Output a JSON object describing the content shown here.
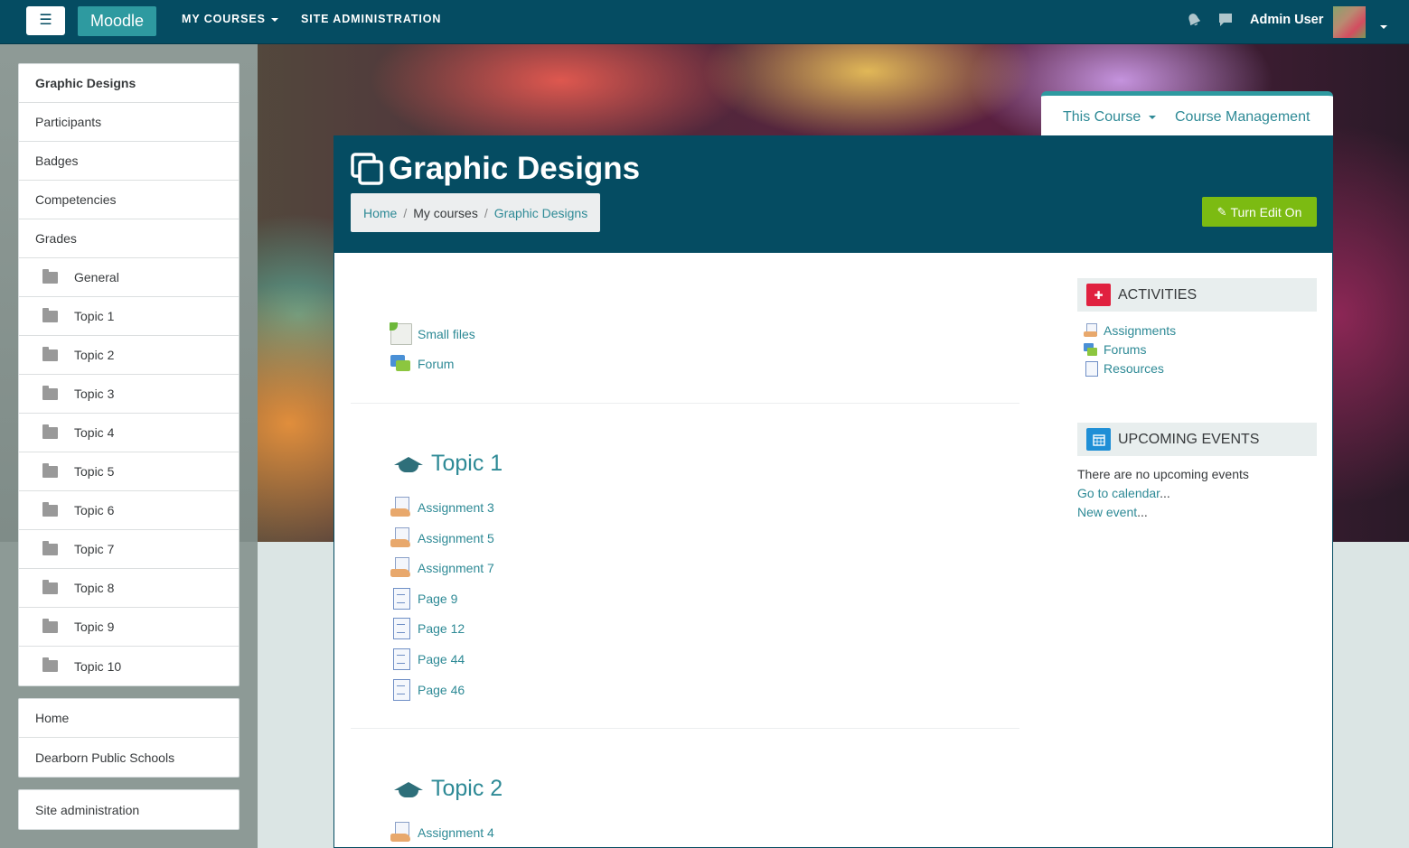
{
  "navbar": {
    "toggle_icon": "☰",
    "brand": "Moodle",
    "my_courses": "MY COURSES",
    "site_admin": "SITE ADMINISTRATION",
    "notifications_icon": "bell-icon",
    "messages_icon": "message-icon",
    "user_name": "Admin User"
  },
  "sidebar": {
    "course_nav": [
      {
        "label": "Graphic Designs",
        "bold": true
      },
      {
        "label": "Participants"
      },
      {
        "label": "Badges"
      },
      {
        "label": "Competencies"
      },
      {
        "label": "Grades"
      },
      {
        "label": "General",
        "folder": true
      },
      {
        "label": "Topic 1",
        "folder": true
      },
      {
        "label": "Topic 2",
        "folder": true
      },
      {
        "label": "Topic 3",
        "folder": true
      },
      {
        "label": "Topic 4",
        "folder": true
      },
      {
        "label": "Topic 5",
        "folder": true
      },
      {
        "label": "Topic 6",
        "folder": true
      },
      {
        "label": "Topic 7",
        "folder": true
      },
      {
        "label": "Topic 8",
        "folder": true
      },
      {
        "label": "Topic 9",
        "folder": true
      },
      {
        "label": "Topic 10",
        "folder": true
      }
    ],
    "site_nav": [
      "Home",
      "Dearborn Public Schools"
    ],
    "admin_nav": [
      "Site administration"
    ]
  },
  "course_tabs": {
    "this_course": "This Course",
    "course_management": "Course Management"
  },
  "header": {
    "title": "Graphic Designs",
    "breadcrumb": {
      "home": "Home",
      "sep": "/",
      "my_courses": "My courses",
      "current": "Graphic Designs"
    },
    "edit_button": "Turn Edit On"
  },
  "content": {
    "general_activities": [
      {
        "label": "Small files",
        "icon": "file"
      },
      {
        "label": "Forum",
        "icon": "forum"
      }
    ],
    "topic1": {
      "title": "Topic 1",
      "activities": [
        {
          "label": "Assignment 3",
          "icon": "assign"
        },
        {
          "label": "Assignment 5",
          "icon": "assign"
        },
        {
          "label": "Assignment 7",
          "icon": "assign"
        },
        {
          "label": "Page 9",
          "icon": "page"
        },
        {
          "label": "Page 12",
          "icon": "page"
        },
        {
          "label": "Page 44",
          "icon": "page"
        },
        {
          "label": "Page 46",
          "icon": "page"
        }
      ]
    },
    "topic2": {
      "title": "Topic 2",
      "activities": [
        {
          "label": "Assignment 4",
          "icon": "assign"
        }
      ]
    }
  },
  "blocks": {
    "activities": {
      "title": "ACTIVITIES",
      "icon_color": "#e0213f",
      "links": [
        {
          "label": "Assignments",
          "icon": "assign"
        },
        {
          "label": "Forums",
          "icon": "forum"
        },
        {
          "label": "Resources",
          "icon": "page"
        }
      ]
    },
    "upcoming": {
      "title": "UPCOMING EVENTS",
      "icon_color": "#1f8fd6",
      "empty_text": "There are no upcoming events",
      "go_to_calendar": "Go to calendar",
      "new_event": "New event",
      "ellipsis": "..."
    }
  },
  "colors": {
    "navbar": "#054c62",
    "brand": "#2e9aa0",
    "link": "#2e8a96",
    "edit_button": "#7cbb12"
  }
}
